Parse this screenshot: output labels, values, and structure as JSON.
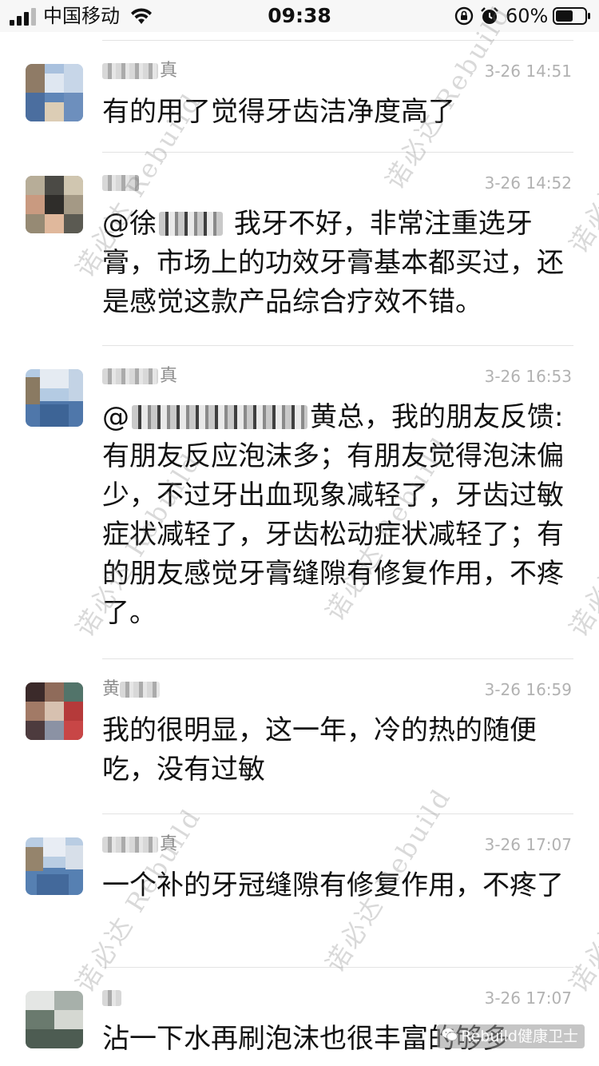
{
  "status_bar": {
    "carrier": "中国移动",
    "time": "09:38",
    "battery_percent": "60%",
    "battery_level": 0.6,
    "icons": [
      "signal-icon",
      "wifi-icon",
      "rotation-lock-icon",
      "alarm-icon",
      "battery-icon"
    ]
  },
  "messages": [
    {
      "sender": "真",
      "time": "3-26 14:51",
      "text": "有的用了觉得牙齿洁净度高了"
    },
    {
      "sender": "",
      "time": "3-26 14:52",
      "text_prefix": "@徐",
      "text": "我牙不好，非常注重选牙膏，市场上的功效牙膏基本都买过，还是感觉这款产品综合疗效不错。"
    },
    {
      "sender": "真",
      "time": "3-26 16:53",
      "text_prefix": "@",
      "text": "黄总，我的朋友反馈:有朋友反应泡沫多；有朋友觉得泡沫偏少，不过牙出血现象减轻了，牙齿过敏症状减轻了，牙齿松动症状减轻了；有的朋友感觉牙膏缝隙有修复作用，不疼了。"
    },
    {
      "sender": "黄",
      "time": "3-26 16:59",
      "text": "我的很明显，这一年，冷的热的随便吃，没有过敏"
    },
    {
      "sender": "真",
      "time": "3-26 17:07",
      "text": "一个补的牙冠缝隙有修复作用，不疼了"
    },
    {
      "sender": "",
      "time": "3-26 17:07",
      "text": "沾一下水再刷泡沫也很丰富的够多"
    }
  ],
  "watermark": {
    "text": "诺必达 Rebuild"
  },
  "channel_badge": {
    "text": "Rebuild健康卫士"
  },
  "colors": {
    "status_bar_bg": "#f7f7f7",
    "divider": "#e3e3e3",
    "sender": "#8c8c8c",
    "time": "#b2b2b2",
    "text": "#111111"
  }
}
